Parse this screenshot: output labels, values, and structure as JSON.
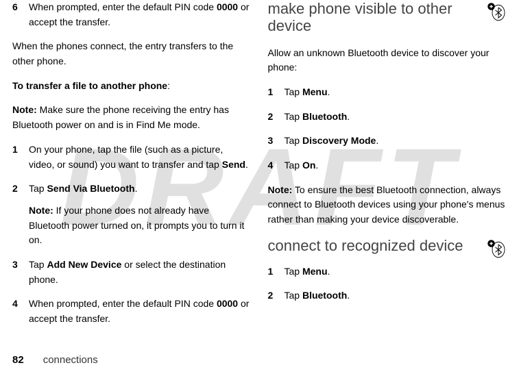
{
  "watermark": "DRAFT",
  "left": {
    "step6_num": "6",
    "step6_text_a": "When prompted, enter the default PIN code ",
    "step6_pin": "0000",
    "step6_text_b": " or accept the transfer.",
    "para_connect": "When the phones connect, the entry transfers to the other phone.",
    "transfer_heading": "To transfer a file to another phone",
    "colon": ":",
    "note_label": "Note:",
    "note_transfer": " Make sure the phone receiving the entry has Bluetooth power on and is in Find Me mode.",
    "s1_num": "1",
    "s1_text_a": "On your phone, tap the file (such as a picture, video, or sound) you want to transfer and tap ",
    "s1_send": "Send",
    "s1_text_b": ".",
    "s2_num": "2",
    "s2_text_a": "Tap ",
    "s2_svb": "Send Via Bluetooth",
    "s2_text_b": ".",
    "s2_note_label": "Note:",
    "s2_note_text": " If your phone does not already have Bluetooth power turned on, it prompts you to turn it on.",
    "s3_num": "3",
    "s3_text_a": "Tap ",
    "s3_add": "Add New Device",
    "s3_text_b": " or select the destination phone.",
    "s4_num": "4",
    "s4_text_a": "When prompted, enter the default PIN code ",
    "s4_pin": "0000",
    "s4_text_b": " or accept the transfer."
  },
  "right": {
    "h_visible": "make phone visible to other device",
    "p_allow": "Allow an unknown Bluetooth device to discover your phone:",
    "v1_num": "1",
    "v1_a": "Tap ",
    "v1_menu": "Menu",
    "v1_b": ".",
    "v2_num": "2",
    "v2_a": "Tap ",
    "v2_bt": "Bluetooth",
    "v2_b": ".",
    "v3_num": "3",
    "v3_a": "Tap ",
    "v3_dm": "Discovery Mode",
    "v3_b": ".",
    "v4_num": "4",
    "v4_a": "Tap ",
    "v4_on": "On",
    "v4_b": ".",
    "note_label": "Note:",
    "note_best": " To ensure the best Bluetooth connection, always connect to Bluetooth devices using your phone's menus rather than making your device discoverable.",
    "h_connect": "connect to recognized device",
    "c1_num": "1",
    "c1_a": "Tap ",
    "c1_menu": "Menu",
    "c1_b": ".",
    "c2_num": "2",
    "c2_a": "Tap ",
    "c2_bt": "Bluetooth",
    "c2_b": "."
  },
  "footer": {
    "page": "82",
    "chapter": "connections"
  }
}
